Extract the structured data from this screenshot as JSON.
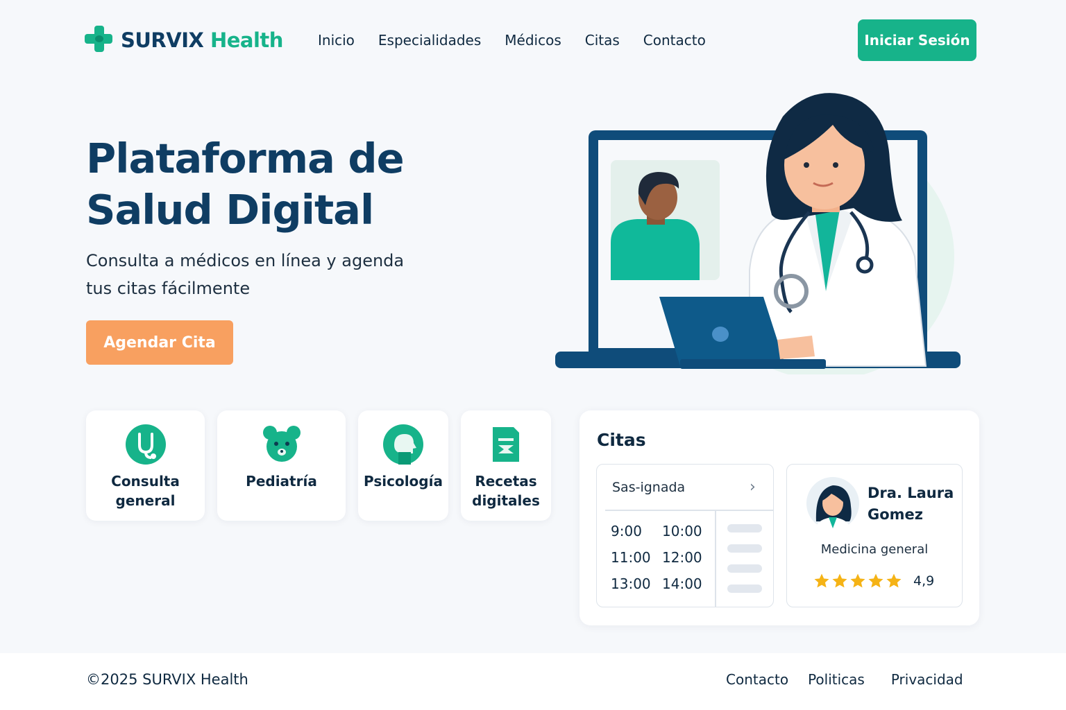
{
  "brand": {
    "name_part1": "SURVIX",
    "name_part2": "Health",
    "primary_color": "#17b38a",
    "dark_color": "#0f3d63",
    "accent_color": "#f8a060"
  },
  "nav": {
    "items": [
      "Inicio",
      "Especialidades",
      "Médicos",
      "Citas",
      "Contacto"
    ]
  },
  "header": {
    "login_label": "Iniciar Sesión"
  },
  "hero": {
    "title_line1": "Plataforma de",
    "title_line2": "Salud Digital",
    "subtitle_line1": "Consulta a médicos en línea y agenda",
    "subtitle_line2": "tus citas fácilmente",
    "cta_label": "Agendar Cita"
  },
  "services": [
    {
      "line1": "Consulta",
      "line2": "general",
      "icon": "stethoscope-icon"
    },
    {
      "line1": "Pediatría",
      "line2": "",
      "icon": "teddy-bear-icon"
    },
    {
      "line1": "Psicología",
      "line2": "",
      "icon": "head-icon"
    },
    {
      "line1": "Recetas",
      "line2": "digitales",
      "icon": "prescription-icon"
    }
  ],
  "citas": {
    "title": "Citas",
    "schedule_header": "Sas-ignada",
    "times": [
      "9:00",
      "10:00",
      "11:00",
      "12:00",
      "13:00",
      "14:00"
    ],
    "doctor": {
      "name_line1": "Dra. Laura",
      "name_line2": "Gomez",
      "specialty": "Medicina general",
      "stars": 5,
      "rating": "4,9"
    }
  },
  "footer": {
    "copyright": "©2025 SURVIX Health",
    "links": [
      "Contacto",
      "Politicas",
      "Privacidad"
    ]
  }
}
